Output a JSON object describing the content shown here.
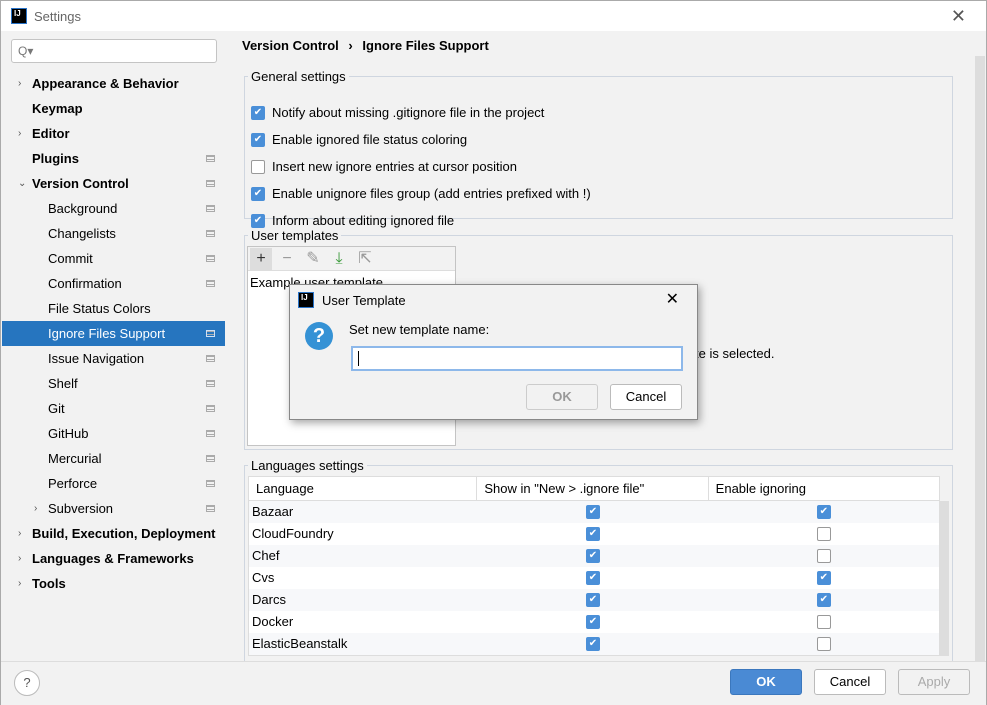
{
  "window": {
    "title": "Settings",
    "close": "✕"
  },
  "search": {
    "placeholder": "Q▾"
  },
  "sidebar": {
    "items": [
      {
        "label": "Appearance & Behavior",
        "bold": true,
        "arrow": "›"
      },
      {
        "label": "Keymap",
        "bold": true
      },
      {
        "label": "Editor",
        "bold": true,
        "arrow": "›"
      },
      {
        "label": "Plugins",
        "bold": true,
        "cfg": true
      },
      {
        "label": "Version Control",
        "bold": true,
        "arrow": "⌄",
        "cfg": true
      },
      {
        "label": "Background",
        "sub": true,
        "cfg": true
      },
      {
        "label": "Changelists",
        "sub": true,
        "cfg": true
      },
      {
        "label": "Commit",
        "sub": true,
        "cfg": true
      },
      {
        "label": "Confirmation",
        "sub": true,
        "cfg": true
      },
      {
        "label": "File Status Colors",
        "sub": true
      },
      {
        "label": "Ignore Files Support",
        "sub": true,
        "cfg": true,
        "selected": true
      },
      {
        "label": "Issue Navigation",
        "sub": true,
        "cfg": true
      },
      {
        "label": "Shelf",
        "sub": true,
        "cfg": true
      },
      {
        "label": "Git",
        "sub": true,
        "cfg": true
      },
      {
        "label": "GitHub",
        "sub": true,
        "cfg": true
      },
      {
        "label": "Mercurial",
        "sub": true,
        "cfg": true
      },
      {
        "label": "Perforce",
        "sub": true,
        "cfg": true
      },
      {
        "label": "Subversion",
        "sub": true,
        "arrow": "›",
        "cfg": true
      },
      {
        "label": "Build, Execution, Deployment",
        "bold": true,
        "arrow": "›"
      },
      {
        "label": "Languages & Frameworks",
        "bold": true,
        "arrow": "›"
      },
      {
        "label": "Tools",
        "bold": true,
        "arrow": "›"
      }
    ]
  },
  "breadcrumb": {
    "parent": "Version Control",
    "sep": "›",
    "current": "Ignore Files Support"
  },
  "general": {
    "legend": "General settings",
    "options": [
      {
        "label": "Notify about missing .gitignore file in the project",
        "checked": true
      },
      {
        "label": "Enable ignored file status coloring",
        "checked": true
      },
      {
        "label": "Insert new ignore entries at cursor position",
        "checked": false
      },
      {
        "label": "Enable unignore files group (add entries prefixed with !)",
        "checked": true
      },
      {
        "label": "Inform about editing ignored file",
        "checked": true
      }
    ]
  },
  "templates": {
    "legend": "User templates",
    "toolbar": [
      "+",
      "−",
      "✎",
      "⤓",
      "⇱"
    ],
    "items": [
      "Example user template"
    ],
    "hint_fragment": "te is selected."
  },
  "languages": {
    "legend": "Languages settings",
    "columns": [
      "Language",
      "Show in \"New > .ignore file\"",
      "Enable ignoring"
    ],
    "rows": [
      [
        "Bazaar",
        true,
        true
      ],
      [
        "CloudFoundry",
        true,
        false
      ],
      [
        "Chef",
        true,
        false
      ],
      [
        "Cvs",
        true,
        true
      ],
      [
        "Darcs",
        true,
        true
      ],
      [
        "Docker",
        true,
        false
      ],
      [
        "ElasticBeanstalk",
        true,
        false
      ]
    ]
  },
  "footer": {
    "help": "?",
    "ok": "OK",
    "cancel": "Cancel",
    "apply": "Apply"
  },
  "dialog": {
    "title": "User Template",
    "prompt": "Set new template name:",
    "value": "",
    "ok": "OK",
    "cancel": "Cancel",
    "close": "✕"
  }
}
